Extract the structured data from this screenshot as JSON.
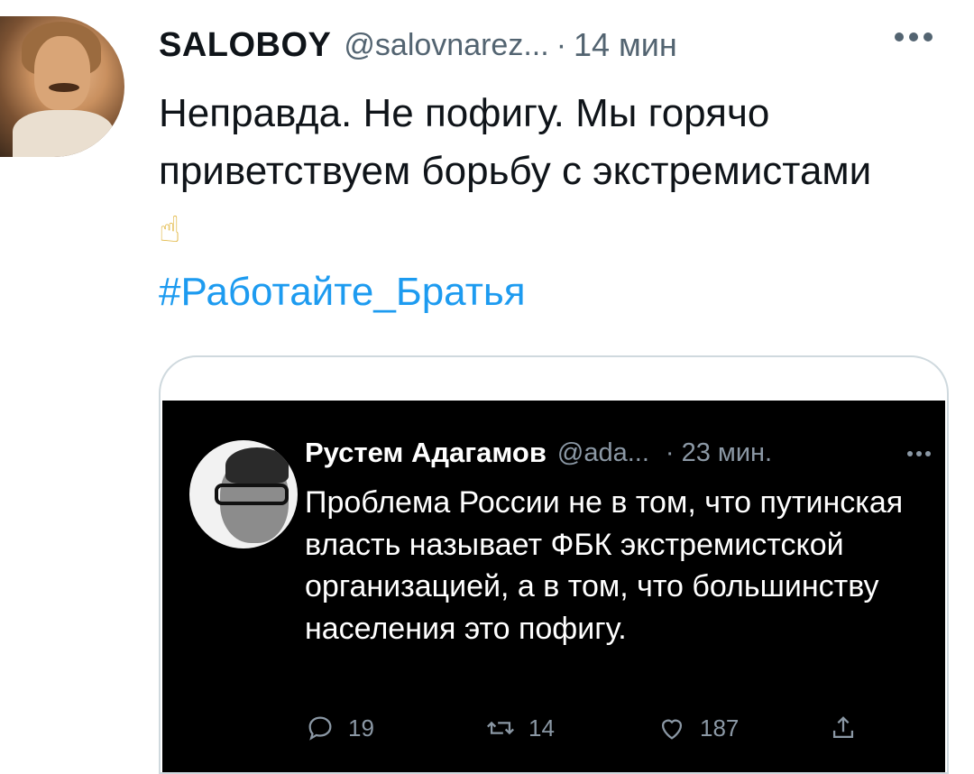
{
  "tweet": {
    "display_name": "SALOBOY",
    "handle": "@salovnarez...",
    "separator": "·",
    "time": "14 мин",
    "text": "Неправда. Не пофигу. Мы горячо приветствуем борьбу с экстремистами",
    "emoji": "☝",
    "hashtag": "#Работайте_Братья"
  },
  "quoted": {
    "display_name": "Рустем Адагамов",
    "handle": "@ada...",
    "separator": "·",
    "time": "23 мин.",
    "text": "Проблема России не в том, что путинская власть называет ФБК экстремистской организацией, а в том, что большинству населения это пофигу.",
    "replies": "19",
    "retweets": "14",
    "likes": "187"
  },
  "colors": {
    "link": "#1d9bf0",
    "text": "#0f1419",
    "muted": "#536471",
    "dark_bg": "#000000"
  },
  "icons": [
    "more-icon",
    "reply-icon",
    "retweet-icon",
    "like-icon",
    "share-icon"
  ]
}
